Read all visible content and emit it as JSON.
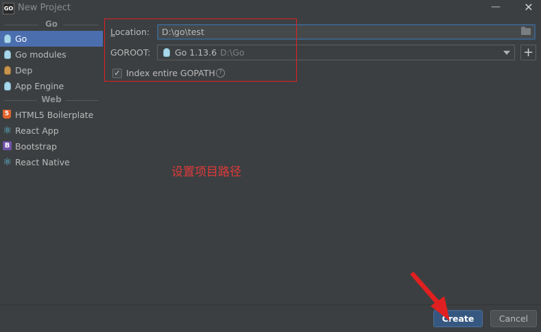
{
  "window": {
    "title": "New Project",
    "app_icon_text": "GO",
    "minimize_glyph": "—",
    "close_glyph": "✕"
  },
  "sidebar": {
    "groups": [
      {
        "header": "Go",
        "items": [
          {
            "label": "Go",
            "icon": "gopher-icon",
            "selected": true
          },
          {
            "label": "Go modules",
            "icon": "gopher-icon"
          },
          {
            "label": "Dep",
            "icon": "dep-gopher-icon"
          },
          {
            "label": "App Engine",
            "icon": "app-engine-icon"
          }
        ]
      },
      {
        "header": "Web",
        "items": [
          {
            "label": "HTML5 Boilerplate",
            "icon": "html5-icon"
          },
          {
            "label": "React App",
            "icon": "react-icon"
          },
          {
            "label": "Bootstrap",
            "icon": "bootstrap-icon"
          },
          {
            "label": "React Native",
            "icon": "react-icon"
          }
        ]
      }
    ]
  },
  "form": {
    "location_label_prefix": "L",
    "location_label_rest": "ocation:",
    "location_value": "D:\\go\\test",
    "goroot_label": "GOROOT:",
    "goroot_value": "Go 1.13.6",
    "goroot_path": "D:\\Go",
    "add_glyph": "+",
    "index_gopath_label": "Index entire GOPATH",
    "index_gopath_checked": true,
    "check_glyph": "✓",
    "help_glyph": "?"
  },
  "annotation": {
    "text": "设置项目路径",
    "color": "#e03a3a"
  },
  "buttons": {
    "create": "Create",
    "cancel": "Cancel"
  },
  "icons": {
    "html5_glyph": "5",
    "bootstrap_glyph": "B",
    "react_glyph": "⚛"
  },
  "colors": {
    "selection": "#4b6eaf",
    "primary_button": "#365880",
    "highlight_box": "#e02020"
  }
}
